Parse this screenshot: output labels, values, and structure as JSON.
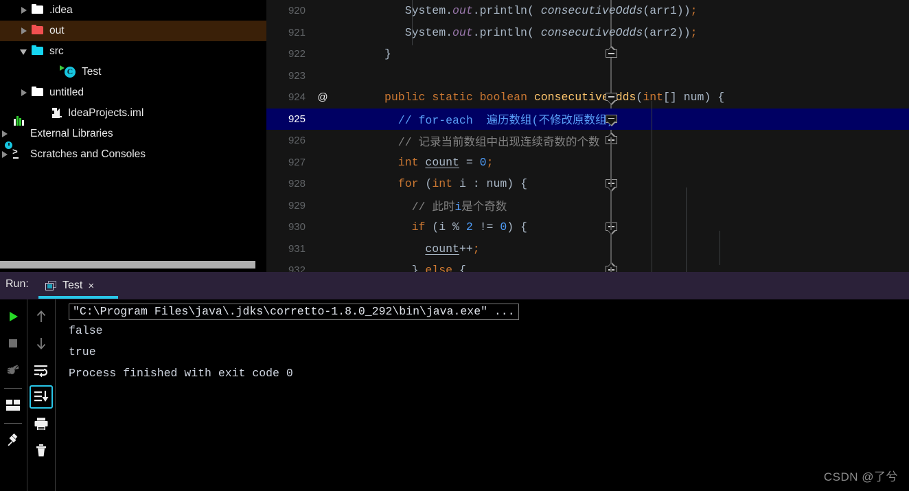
{
  "project_tree": {
    "items": [
      {
        "label": ".idea",
        "icon": "folder-icon",
        "arrow": "closed",
        "indent": 28,
        "selected": false,
        "color": "#ffffff"
      },
      {
        "label": "out",
        "icon": "folder-icon",
        "arrow": "closed",
        "indent": 28,
        "selected": true,
        "color": "#f15050"
      },
      {
        "label": "src",
        "icon": "folder-icon",
        "arrow": "open",
        "indent": 28,
        "selected": false,
        "color": "#16d5f0"
      },
      {
        "label": "Test",
        "icon": "java-class-icon",
        "arrow": "none",
        "indent": 75,
        "selected": false,
        "color": "#16d5f0"
      },
      {
        "label": "untitled",
        "icon": "folder-icon",
        "arrow": "closed",
        "indent": 28,
        "selected": false,
        "color": "#ffffff"
      },
      {
        "label": "IdeaProjects.iml",
        "icon": "iml-file-icon",
        "arrow": "none",
        "indent": 55,
        "selected": false,
        "color": "#ffffff"
      },
      {
        "label": "External Libraries",
        "icon": "external-libraries-icon",
        "arrow": "closed",
        "indent": 0,
        "selected": false,
        "color": "#ffffff"
      },
      {
        "label": "Scratches and Consoles",
        "icon": "scratches-icon",
        "arrow": "closed",
        "indent": 0,
        "selected": false,
        "color": "#ffffff"
      }
    ]
  },
  "editor": {
    "highlighted_line": 925,
    "annotation_marker": "@",
    "annotation_line": 924,
    "lines": [
      {
        "num": "920",
        "indent": 3,
        "tokens": [
          {
            "t": "System",
            "c": "plain"
          },
          {
            "t": ".",
            "c": "punct"
          },
          {
            "t": "out",
            "c": "fld"
          },
          {
            "t": ".",
            "c": "punct"
          },
          {
            "t": "println",
            "c": "plain"
          },
          {
            "t": "( ",
            "c": "punct"
          },
          {
            "t": "consecutiveOdds",
            "c": "mth"
          },
          {
            "t": "(arr1)",
            "c": "punct"
          },
          {
            "t": ")",
            "c": "punct"
          },
          {
            "t": ";",
            "c": "semi"
          }
        ]
      },
      {
        "num": "921",
        "indent": 3,
        "tokens": [
          {
            "t": "System",
            "c": "plain"
          },
          {
            "t": ".",
            "c": "punct"
          },
          {
            "t": "out",
            "c": "fld"
          },
          {
            "t": ".",
            "c": "punct"
          },
          {
            "t": "println",
            "c": "plain"
          },
          {
            "t": "( ",
            "c": "punct"
          },
          {
            "t": "consecutiveOdds",
            "c": "mth"
          },
          {
            "t": "(arr2)",
            "c": "punct"
          },
          {
            "t": ")",
            "c": "punct"
          },
          {
            "t": ";",
            "c": "semi"
          }
        ]
      },
      {
        "num": "922",
        "indent": 0,
        "tokens": [
          {
            "t": "}",
            "c": "plain"
          }
        ]
      },
      {
        "num": "923",
        "indent": 0,
        "tokens": []
      },
      {
        "num": "924",
        "indent": 0,
        "tokens": [
          {
            "t": "public",
            "c": "kw"
          },
          {
            "t": " ",
            "c": "plain"
          },
          {
            "t": "static",
            "c": "kw"
          },
          {
            "t": " ",
            "c": "plain"
          },
          {
            "t": "boolean",
            "c": "kw"
          },
          {
            "t": " ",
            "c": "plain"
          },
          {
            "t": "consecutiveOdds",
            "c": "fn"
          },
          {
            "t": "(",
            "c": "punct"
          },
          {
            "t": "int",
            "c": "kw"
          },
          {
            "t": "[] num) {",
            "c": "punct"
          }
        ]
      },
      {
        "num": "925",
        "indent": 2,
        "tokens": [
          {
            "t": "// ",
            "c": "cmtk"
          },
          {
            "t": "for-each",
            "c": "cmtk"
          },
          {
            "t": "  遍历数组(不修改原数组)",
            "c": "cmtk"
          }
        ]
      },
      {
        "num": "926",
        "indent": 2,
        "tokens": [
          {
            "t": "// ",
            "c": "cmt"
          },
          {
            "t": "记录当前数组中出现连续奇数的个数",
            "c": "cmt"
          }
        ]
      },
      {
        "num": "927",
        "indent": 2,
        "tokens": [
          {
            "t": "int",
            "c": "kw"
          },
          {
            "t": " ",
            "c": "plain"
          },
          {
            "t": "count",
            "c": "ul"
          },
          {
            "t": " = ",
            "c": "punct"
          },
          {
            "t": "0",
            "c": "num"
          },
          {
            "t": ";",
            "c": "semi"
          }
        ]
      },
      {
        "num": "928",
        "indent": 2,
        "tokens": [
          {
            "t": "for",
            "c": "kw"
          },
          {
            "t": " (",
            "c": "punct"
          },
          {
            "t": "int",
            "c": "kw"
          },
          {
            "t": " i : num) {",
            "c": "punct"
          }
        ]
      },
      {
        "num": "929",
        "indent": 4,
        "tokens": [
          {
            "t": "// ",
            "c": "cmt"
          },
          {
            "t": "此时",
            "c": "cmt"
          },
          {
            "t": "i",
            "c": "cmtk"
          },
          {
            "t": "是个奇数",
            "c": "cmt"
          }
        ]
      },
      {
        "num": "930",
        "indent": 4,
        "tokens": [
          {
            "t": "if",
            "c": "kw"
          },
          {
            "t": " (i % ",
            "c": "punct"
          },
          {
            "t": "2",
            "c": "num"
          },
          {
            "t": " != ",
            "c": "punct"
          },
          {
            "t": "0",
            "c": "num"
          },
          {
            "t": ") {",
            "c": "punct"
          }
        ]
      },
      {
        "num": "931",
        "indent": 6,
        "tokens": [
          {
            "t": "count",
            "c": "ul"
          },
          {
            "t": "++",
            "c": "punct"
          },
          {
            "t": ";",
            "c": "semi"
          }
        ]
      },
      {
        "num": "932",
        "indent": 4,
        "tokens": [
          {
            "t": "} ",
            "c": "punct"
          },
          {
            "t": "else",
            "c": "kw"
          },
          {
            "t": " {",
            "c": "punct"
          }
        ]
      }
    ],
    "fold_markers": [
      {
        "line": "922",
        "type": "up"
      },
      {
        "line": "924",
        "type": "down"
      },
      {
        "line": "925",
        "type": "down"
      },
      {
        "line": "926",
        "type": "up"
      },
      {
        "line": "928",
        "type": "down"
      },
      {
        "line": "930",
        "type": "down"
      },
      {
        "line": "932",
        "type": "up"
      }
    ]
  },
  "run_panel": {
    "label": "Run:",
    "tab": {
      "title": "Test",
      "close": "×",
      "icon": "run-config-icon"
    },
    "accent_color": "#29c6e8",
    "header_bg": "#2b2139",
    "toolbar_left": [
      {
        "name": "rerun-button",
        "icon": "play-icon"
      },
      {
        "name": "stop-button",
        "icon": "stop-square-icon"
      },
      {
        "name": "rerun-failed-button",
        "icon": "bug-rerun-icon"
      },
      {
        "name": "layout-button",
        "icon": "layout-icon"
      },
      {
        "name": "pin-tab-button",
        "icon": "pin-icon"
      }
    ],
    "toolbar_right": [
      {
        "name": "up-stack-button",
        "icon": "arrow-up-icon",
        "active": false
      },
      {
        "name": "down-stack-button",
        "icon": "arrow-down-icon",
        "active": false
      },
      {
        "name": "soft-wrap-button",
        "icon": "soft-wrap-icon",
        "active": false
      },
      {
        "name": "scroll-to-end-button",
        "icon": "scroll-to-end-icon",
        "active": true
      },
      {
        "name": "print-button",
        "icon": "printer-icon",
        "active": false
      },
      {
        "name": "clear-all-button",
        "icon": "trash-icon",
        "active": false
      }
    ],
    "console": {
      "command": "\"C:\\Program Files\\java\\.jdks\\corretto-1.8.0_292\\bin\\java.exe\" ...",
      "output": [
        "false",
        "true",
        "",
        "Process finished with exit code 0"
      ]
    }
  },
  "watermark": "CSDN @了兮"
}
